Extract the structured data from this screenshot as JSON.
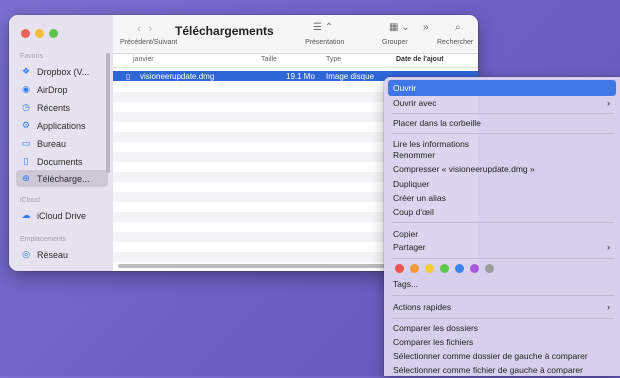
{
  "finder": {
    "title": "Téléchargements",
    "nav_label": "Précédent/Suivant",
    "toolbar": {
      "presentation_label": "Présentation",
      "group_label": "Grouper",
      "search_label": "Rechercher"
    },
    "sidebar": {
      "favorites_header": "Favoris",
      "items": [
        {
          "label": "Dropbox (V...",
          "icon": "dropbox-icon"
        },
        {
          "label": "AirDrop",
          "icon": "airdrop-icon"
        },
        {
          "label": "Récents",
          "icon": "clock-icon"
        },
        {
          "label": "Applications",
          "icon": "applications-icon"
        },
        {
          "label": "Bureau",
          "icon": "desktop-icon"
        },
        {
          "label": "Documents",
          "icon": "document-icon"
        },
        {
          "label": "Télécharge...",
          "icon": "download-icon",
          "selected": true
        }
      ],
      "icloud_header": "iCloud",
      "icloud_items": [
        {
          "label": "iCloud Drive",
          "icon": "cloud-icon"
        }
      ],
      "locations_header": "Emplacements",
      "location_items": [
        {
          "label": "Réseau",
          "icon": "network-icon"
        }
      ]
    },
    "columns": {
      "name": "janvier",
      "size": "Taille",
      "type": "Type",
      "date": "Date de l'ajout"
    },
    "files": [
      {
        "name": "visioneerupdate.dmg",
        "size": "19.1 Mo",
        "type": "Image disque"
      }
    ]
  },
  "context_menu": {
    "items": {
      "ouvrir": "Ouvrir",
      "ouvrir_avec": "Ouvrir avec",
      "corbeille": "Placer dans la corbeille",
      "infos": "Lire les informations",
      "renommer": "Renommer",
      "compresser": "Compresser « visioneerupdate.dmg »",
      "dupliquer": "Dupliquer",
      "alias": "Créer un alias",
      "coup_oeil": "Coup d'œil",
      "copier": "Copier",
      "partager": "Partager",
      "tags": "Tags...",
      "actions_rapides": "Actions rapides",
      "comparer_dossiers": "Comparer les dossiers",
      "comparer_fichiers": "Comparer les fichiers",
      "sel_dossier_gauche": "Sélectionner comme dossier de gauche à comparer",
      "sel_fichier_gauche": "Sélectionner comme fichier de gauche à comparer"
    },
    "tag_colors": [
      "#f0524f",
      "#f6983a",
      "#f5cd3a",
      "#5fc747",
      "#3b82f0",
      "#a55bdb",
      "#9c9c9c"
    ]
  }
}
